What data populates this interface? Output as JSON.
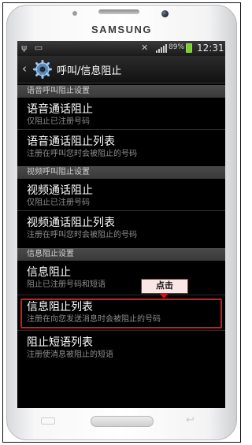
{
  "device": {
    "brand": "SAMSUNG"
  },
  "status_bar": {
    "battery_percent": "89%",
    "time": "12:31",
    "left_icons": [
      "usb-icon",
      "notification-icon"
    ],
    "right_icons": [
      "mute-icon",
      "signal-icon",
      "battery-icon"
    ],
    "battery_color": "#7bcf2b"
  },
  "header": {
    "title": "呼叫/信息阻止",
    "icon": "gear-icon"
  },
  "sections": [
    {
      "header": "语音呼叫阻止设置",
      "items": [
        {
          "label": "语音通话阻止",
          "subtitle": "仅阻止已注册号码"
        },
        {
          "label": "语音通话阻止列表",
          "subtitle": "注册在呼叫您时会被阻止的号码"
        }
      ]
    },
    {
      "header": "视频呼叫阻止设置",
      "items": [
        {
          "label": "视频通话阻止",
          "subtitle": "仅阻止已注册号码"
        },
        {
          "label": "视频通话阻止列表",
          "subtitle": "注册在呼叫您时会被阻止的号码"
        }
      ]
    },
    {
      "header": "信息阻止设置",
      "items": [
        {
          "label": "信息阻止",
          "subtitle": "阻止已注册号码和短语"
        },
        {
          "label": "信息阻止列表",
          "subtitle": "注册在向您发送消息时会被阻止的号码"
        },
        {
          "label": "阻止短语列表",
          "subtitle": "注册使消息被阻止的短语"
        }
      ]
    }
  ],
  "annotation": {
    "callout_text": "点击",
    "highlight_color": "#e0141a"
  }
}
